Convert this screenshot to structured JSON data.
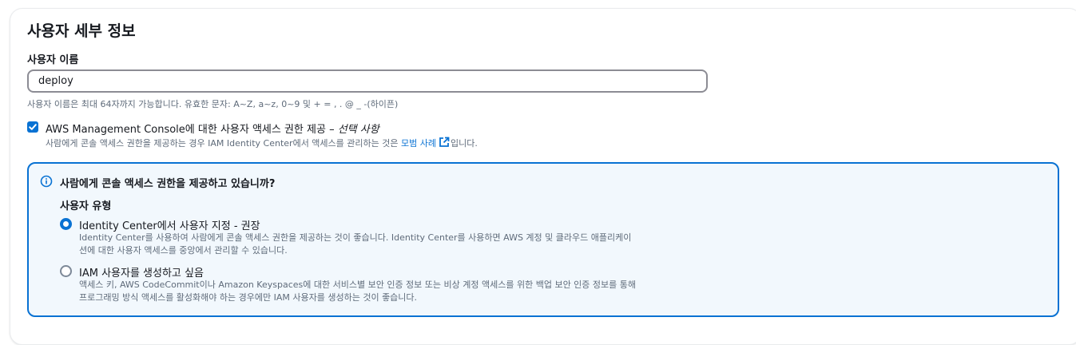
{
  "section": {
    "title": "사용자 세부 정보"
  },
  "username": {
    "label": "사용자 이름",
    "value": "deploy",
    "hint": "사용자 이름은 최대 64자까지 가능합니다. 유효한 문자: A~Z, a~z, 0~9 및 + = , . @ _ -(하이픈)"
  },
  "console_access": {
    "checked": true,
    "label_main": "AWS Management Console에 대한 사용자 액세스 권한 제공 – ",
    "label_optional": "선택 사항",
    "desc_before": "사람에게 콘솔 액세스 권한을 제공하는 경우 IAM Identity Center에서 액세스를 관리하는 것은 ",
    "desc_link": "모범 사례",
    "desc_after": "입니다."
  },
  "alert": {
    "title": "사람에게 콘솔 액세스 권한을 제공하고 있습니까?",
    "user_type_label": "사용자 유형",
    "options": [
      {
        "label": "Identity Center에서 사용자 지정 - 권장",
        "desc_line1": "Identity Center를 사용하여 사람에게 콘솔 액세스 권한을 제공하는 것이 좋습니다. Identity Center를 사용하면 AWS 계정 및 클라우드 애플리케이",
        "desc_line2": "션에 대한 사용자 액세스를 중앙에서 관리할 수 있습니다.",
        "selected": true
      },
      {
        "label": "IAM 사용자를 생성하고 싶음",
        "desc_line1": "액세스 키, AWS CodeCommit이나 Amazon Keyspaces에 대한 서비스별 보안 인증 정보 또는 비상 계정 액세스를 위한 백업 보안 인증 정보를 통해",
        "desc_line2": "프로그래밍 방식 액세스를 활성화해야 하는 경우에만 IAM 사용자를 생성하는 것이 좋습니다.",
        "selected": false
      }
    ]
  },
  "colors": {
    "accent": "#0972d3",
    "alert_bg": "#f2f8fd",
    "muted_text": "#5f6b7a"
  },
  "icons": [
    "checkbox-checked-icon",
    "external-link-icon",
    "info-icon",
    "radio-selected-icon",
    "radio-unselected-icon"
  ]
}
